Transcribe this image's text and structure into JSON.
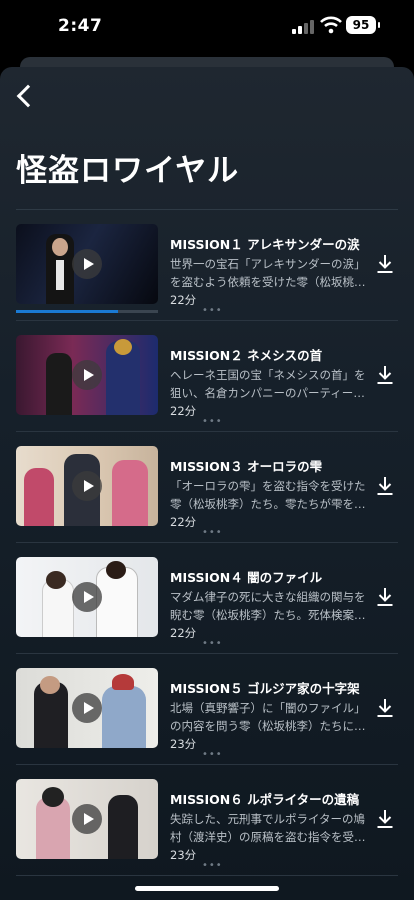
{
  "status": {
    "time": "2:47",
    "battery": "95"
  },
  "header": {
    "title": "怪盗ロワイヤル"
  },
  "episodes": [
    {
      "title": "MISSION１ アレキサンダーの涙",
      "desc": "世界一の宝石「アレキサンダーの涙」を盗むよう依頼を受けた零（松坂桃李）…",
      "duration": "22分",
      "progress": 0.72
    },
    {
      "title": "MISSION２ ネメシスの首",
      "desc": "ヘレーネ王国の宝「ネメシスの首」を狙い、名倉カンパニーのパーティーに…",
      "duration": "22分",
      "progress": 0
    },
    {
      "title": "MISSION３ オーロラの雫",
      "desc": "「オーロラの雫」を盗む指令を受けた零（松坂桃李）たち。零たちが雫を…",
      "duration": "22分",
      "progress": 0
    },
    {
      "title": "MISSION４ 闇のファイル",
      "desc": "マダム律子の死に大きな組織の関与を睨む零（松坂桃李）たち。死体検案…",
      "duration": "22分",
      "progress": 0
    },
    {
      "title": "MISSION５ ゴルジア家の十字架",
      "desc": "北場（真野響子）に「闇のファイル」の内容を問う零（松坂桃李）たちに…",
      "duration": "23分",
      "progress": 0
    },
    {
      "title": "MISSION６ ルポライターの遺稿",
      "desc": "失踪した、元刑事でルポライターの鳩村（渡洋史）の原稿を盗む指令を受…",
      "duration": "23分",
      "progress": 0
    }
  ],
  "icons": {
    "back": "chevron-left-icon",
    "download": "download-icon",
    "play": "play-icon",
    "more": "more-dots-icon"
  },
  "colors": {
    "accent": "#1a7ad4",
    "background": "#16202a"
  }
}
